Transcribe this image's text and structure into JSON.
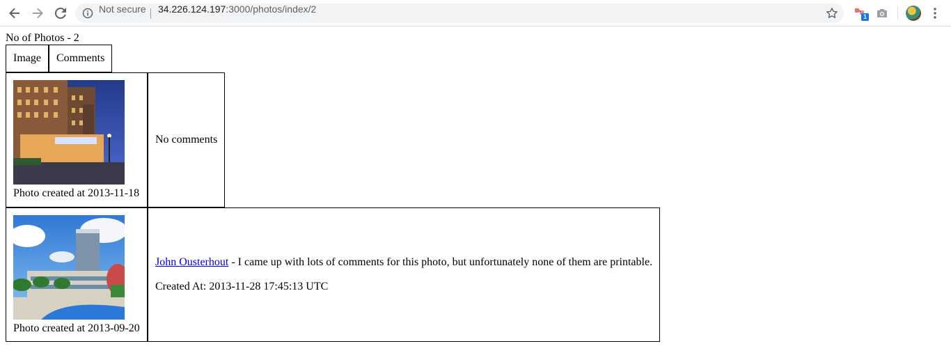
{
  "browser": {
    "security_label": "Not secure",
    "url_host": "34.226.124.197",
    "url_path": ":3000/photos/index/2",
    "extension_badge": "1",
    "icons": [
      "back-arrow-icon",
      "forward-arrow-icon",
      "reload-icon",
      "info-icon",
      "star-icon",
      "extension-icon",
      "camera-icon",
      "menu-icon"
    ]
  },
  "page": {
    "photo_count_text": "No of Photos - 2",
    "headers": {
      "image": "Image",
      "comments": "Comments"
    },
    "photos": [
      {
        "caption": "Photo created at 2013-11-18",
        "no_comments_text": "No comments"
      },
      {
        "caption": "Photo created at 2013-09-20",
        "comment": {
          "author": "John Ousterhout",
          "text": " - I came up with lots of comments for this photo, but unfortunately none of them are printable.",
          "created_at": "Created At: 2013-11-28 17:45:13 UTC"
        }
      }
    ]
  }
}
